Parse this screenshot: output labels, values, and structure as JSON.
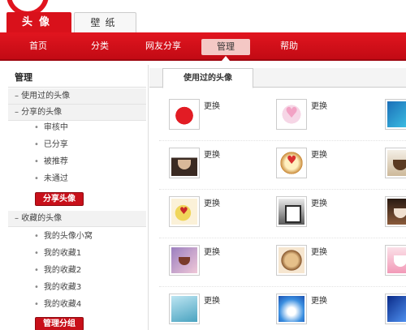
{
  "top_tabs": {
    "avatar": "头像",
    "wallpaper": "壁纸"
  },
  "nav": {
    "items": [
      "首页",
      "分类",
      "网友分享",
      "管理",
      "帮助"
    ],
    "active": "管理"
  },
  "sidebar": {
    "title": "管理",
    "section_used": "– 使用过的头像",
    "section_shared": "– 分享的头像",
    "shared_items": [
      "审核中",
      "已分享",
      "被推荐",
      "未通过"
    ],
    "share_button": "分享头像",
    "section_fav": "– 收藏的头像",
    "fav_items": [
      "我的头像小窝",
      "我的收藏1",
      "我的收藏2",
      "我的收藏3",
      "我的收藏4"
    ],
    "manage_button": "管理分组"
  },
  "content": {
    "tab": "使用过的头像",
    "change_label": "更换",
    "thumbnails": [
      [
        "red-lips",
        "heart-pink",
        "blue-heart"
      ],
      [
        "coffee-cup",
        "gold-heart",
        "coffee-saucer"
      ],
      [
        "yellow-heart-cup",
        "green-mug",
        "dark-coffee"
      ],
      [
        "violet-cup",
        "latte-heart",
        "pink-cup"
      ],
      [
        "teal-scene",
        "sky-scene",
        "deep-blue"
      ]
    ]
  },
  "colors": {
    "brand_red": "#d9111b",
    "nav_active_bg": "#f4c8c5"
  }
}
